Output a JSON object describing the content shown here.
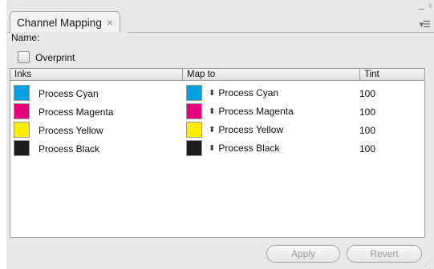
{
  "panel": {
    "tab_title": "Channel Mapping",
    "tab_close": "×",
    "name_label": "Name:",
    "overprint_label": "Overprint",
    "overprint_checked": false,
    "menu_icon": "panel-menu-icon",
    "minimize_glyph": "–",
    "close_glyph": "x"
  },
  "table": {
    "headers": {
      "inks": "Inks",
      "map_to": "Map to",
      "tint": "Tint"
    },
    "rows": [
      {
        "ink": "Process Cyan",
        "color": "#009fe3",
        "map_to": "Process Cyan",
        "map_color": "#009fe3",
        "tint": "100"
      },
      {
        "ink": "Process Magenta",
        "color": "#e5007e",
        "map_to": "Process Magenta",
        "map_color": "#e5007e",
        "tint": "100"
      },
      {
        "ink": "Process Yellow",
        "color": "#ffed00",
        "map_to": "Process Yellow",
        "map_color": "#ffed00",
        "tint": "100"
      },
      {
        "ink": "Process Black",
        "color": "#1d1d1b",
        "map_to": "Process Black",
        "map_color": "#1d1d1b",
        "tint": "100"
      }
    ]
  },
  "buttons": {
    "apply": "Apply",
    "revert": "Revert"
  }
}
